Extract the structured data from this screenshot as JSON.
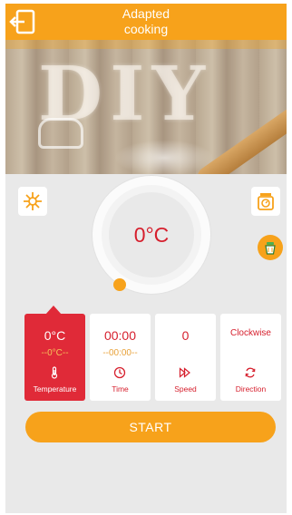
{
  "header": {
    "title_line1": "Adapted",
    "title_line2": "cooking",
    "back_icon": "exit-door-icon"
  },
  "banner": {
    "text": "DIY"
  },
  "controls": {
    "left_icon": "sun-heat-icon",
    "right_icon": "kitchen-scale-icon",
    "recipe_icon": "recipe-basket-icon",
    "dial_value": "0°C"
  },
  "params": [
    {
      "value": "0°C",
      "sub": "--0°C--",
      "label": "Temperature",
      "icon": "thermometer-icon",
      "active": true
    },
    {
      "value": "00:00",
      "sub": "--00:00--",
      "label": "Time",
      "icon": "clock-icon",
      "active": false
    },
    {
      "value": "0",
      "sub": "",
      "label": "Speed",
      "icon": "fast-forward-icon",
      "active": false
    },
    {
      "value": "Clockwise",
      "sub": "",
      "label": "Direction",
      "icon": "rotate-icon",
      "active": false
    }
  ],
  "start_label": "START",
  "colors": {
    "accent": "#f7a21b",
    "red": "#e02a38",
    "background": "#e9e9e9"
  }
}
